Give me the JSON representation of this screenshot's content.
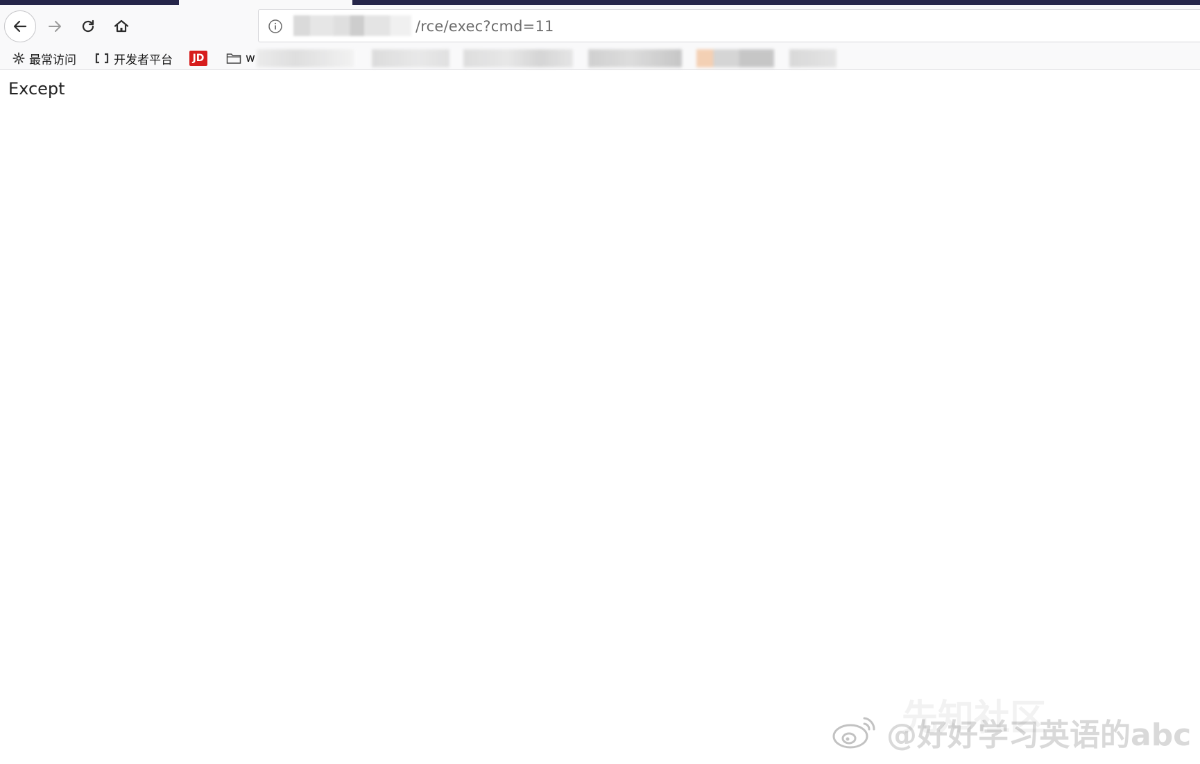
{
  "browser": {
    "toolbar": {
      "back_icon": "arrow-left-icon",
      "forward_icon": "arrow-right-icon",
      "reload_icon": "reload-icon",
      "home_icon": "home-icon"
    },
    "urlbar": {
      "info_icon": "info-icon",
      "url_path": "/rce/exec?cmd=11"
    },
    "bookmarks": [
      {
        "icon": "gear-icon",
        "label": "最常访问"
      },
      {
        "icon": "code-bracket-icon",
        "label": "开发者平台"
      },
      {
        "icon": "jd-logo-icon",
        "label": "JD"
      },
      {
        "icon": "folder-icon",
        "label": "w"
      }
    ]
  },
  "page": {
    "body_text": "Except"
  },
  "watermark": {
    "text": "@好好学习英语的abc",
    "background_text": "先知社区"
  },
  "colors": {
    "tabstrip": "#26264a",
    "toolbar": "#f9f9fa",
    "jd_red": "#d71d1d"
  }
}
